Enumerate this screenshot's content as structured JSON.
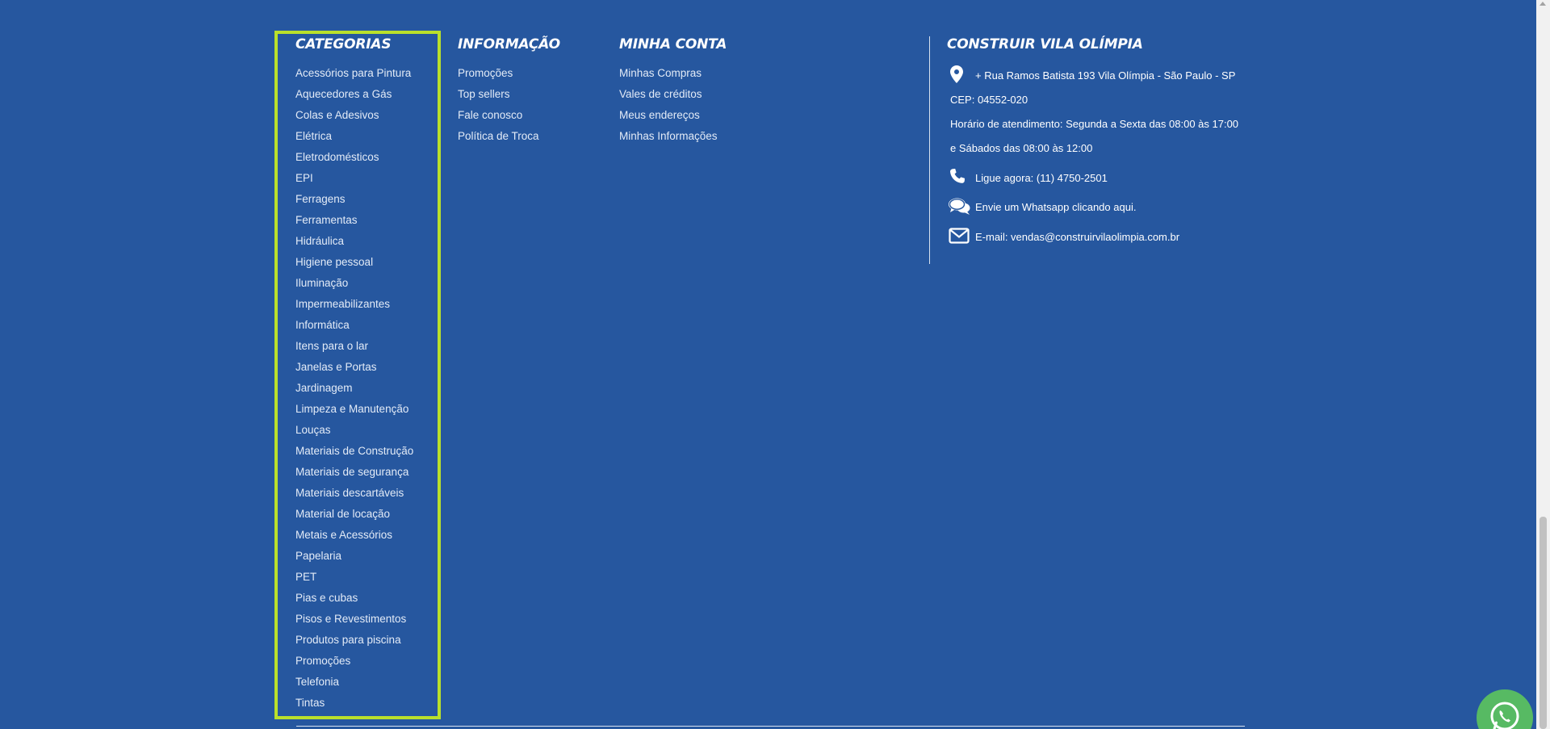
{
  "categories": {
    "title": "CATEGORIAS",
    "items": [
      "Acessórios para Pintura",
      "Aquecedores a Gás",
      "Colas e Adesivos",
      "Elétrica",
      "Eletrodomésticos",
      "EPI",
      "Ferragens",
      "Ferramentas",
      "Hidráulica",
      "Higiene pessoal",
      "Iluminação",
      "Impermeabilizantes",
      "Informática",
      "Itens para o lar",
      "Janelas e Portas",
      "Jardinagem",
      "Limpeza e Manutenção",
      "Louças",
      "Materiais de Construção",
      "Materiais de segurança",
      "Materiais descartáveis",
      "Material de locação",
      "Metais e Acessórios",
      "Papelaria",
      "PET",
      "Pias e cubas",
      "Pisos e Revestimentos",
      "Produtos para piscina",
      "Promoções",
      "Telefonia",
      "Tintas"
    ]
  },
  "informacao": {
    "title": "INFORMAÇÃO",
    "items": [
      "Promoções",
      "Top sellers",
      "Fale conosco",
      "Política de Troca"
    ]
  },
  "minha_conta": {
    "title": "MINHA CONTA",
    "items": [
      "Minhas Compras",
      "Vales de créditos",
      "Meus endereços",
      "Minhas Informações"
    ]
  },
  "contact": {
    "title": "CONSTRUIR VILA OLÍMPIA",
    "address": "+ Rua Ramos Batista 193 Vila Olímpia - São Paulo - SP",
    "cep": "CEP: 04552-020",
    "hours_1": "Horário de atendimento: Segunda a Sexta das 08:00 às 17:00",
    "hours_2": "e Sábados das 08:00 às 12:00",
    "phone": "Ligue agora: (11) 4750-2501",
    "whatsapp": "Envie um Whatsapp clicando aqui.",
    "email": "E-mail: vendas@construirvilaolimpia.com.br"
  },
  "colors": {
    "background": "#26579f",
    "highlight_border": "#b9e02b",
    "whatsapp_green": "#57ba63"
  },
  "icons": {
    "address": "map-marker-icon",
    "phone": "phone-icon",
    "whatsapp": "chat-bubbles-icon",
    "email": "envelope-icon",
    "float": "whatsapp-icon"
  }
}
